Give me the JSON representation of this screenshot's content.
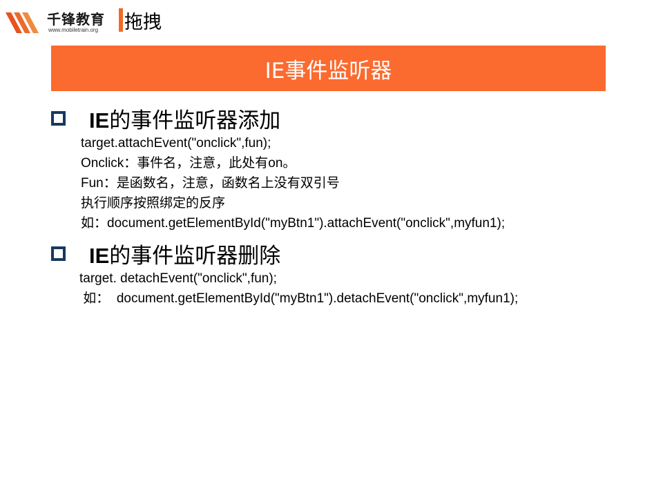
{
  "logo": {
    "name": "千锋教育",
    "url": "www.mobiletrain.org"
  },
  "header": {
    "title": "拖拽"
  },
  "banner": {
    "title": "IE事件监听器"
  },
  "sections": [
    {
      "heading_prefix": "IE",
      "heading_rest": "的事件监听器添加",
      "lines": [
        "target.attachEvent(\"onclick\",fun);",
        "Onclick：事件名，注意，此处有on。",
        "Fun：是函数名，注意，函数名上没有双引号",
        "执行顺序按照绑定的反序",
        "如：document.getElementById(\"myBtn1\").attachEvent(\"onclick\",myfun1);"
      ]
    },
    {
      "heading_prefix": "IE",
      "heading_rest": "的事件监听器删除",
      "lines": [
        "target. detachEvent(\"onclick\",fun);",
        " 如：  document.getElementById(\"myBtn1\").detachEvent(\"onclick\",myfun1);"
      ]
    }
  ],
  "colors": {
    "accent": "#fb6a2f",
    "bullet": "#18385e",
    "logo_stripes": "#e8531e"
  }
}
